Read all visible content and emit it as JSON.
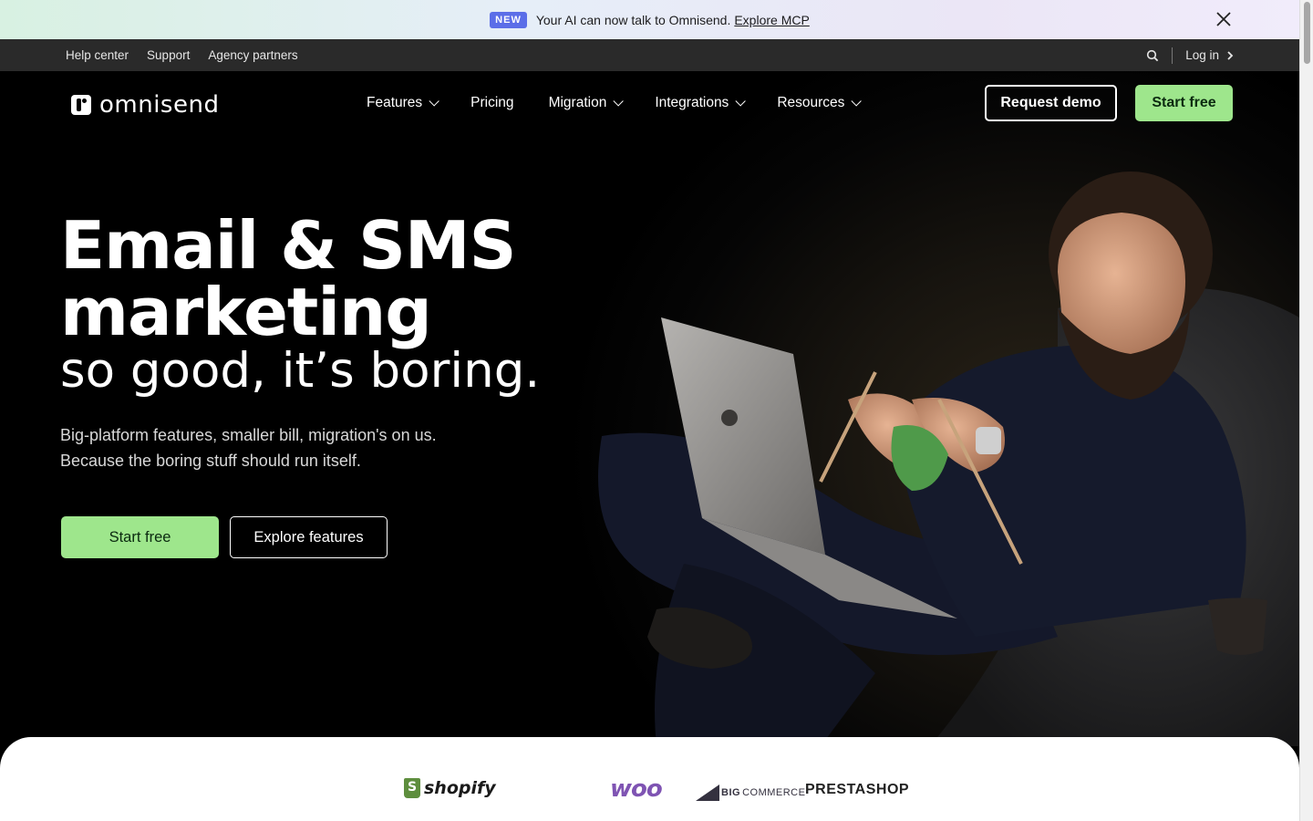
{
  "announcement": {
    "badge": "NEW",
    "text": "Your AI can now talk to Omnisend.",
    "link": "Explore MCP",
    "close_icon": "close-icon"
  },
  "utility_nav": {
    "links": [
      "Help center",
      "Support",
      "Agency partners"
    ],
    "search_icon": "search-icon",
    "login": "Log in",
    "login_icon": "chevron-right-icon"
  },
  "nav": {
    "logo": "omnisend",
    "items": [
      {
        "label": "Features",
        "dropdown": true
      },
      {
        "label": "Pricing",
        "dropdown": false
      },
      {
        "label": "Migration",
        "dropdown": true
      },
      {
        "label": "Integrations",
        "dropdown": true
      },
      {
        "label": "Resources",
        "dropdown": true
      }
    ],
    "request_demo": "Request demo",
    "start_free": "Start free"
  },
  "hero": {
    "headline_line1": "Email & SMS",
    "headline_line2": "marketing",
    "headline_line3": "so good, it’s boring.",
    "subtext_line1": "Big-platform features, smaller bill, migration's on us.",
    "subtext_line2": "Because the boring stuff should run itself.",
    "cta_primary": "Start free",
    "cta_secondary": "Explore features"
  },
  "partners": {
    "shopify": "shopify",
    "woo": "woo",
    "bigcommerce_big": "BIG",
    "bigcommerce": "COMMERCE",
    "prestashop": "PRESTASHOP"
  },
  "colors": {
    "accent_green": "#9ee68c",
    "badge_blue": "#5b6ee8",
    "hero_bg": "#000000",
    "utility_bar": "#2a2a2a"
  }
}
